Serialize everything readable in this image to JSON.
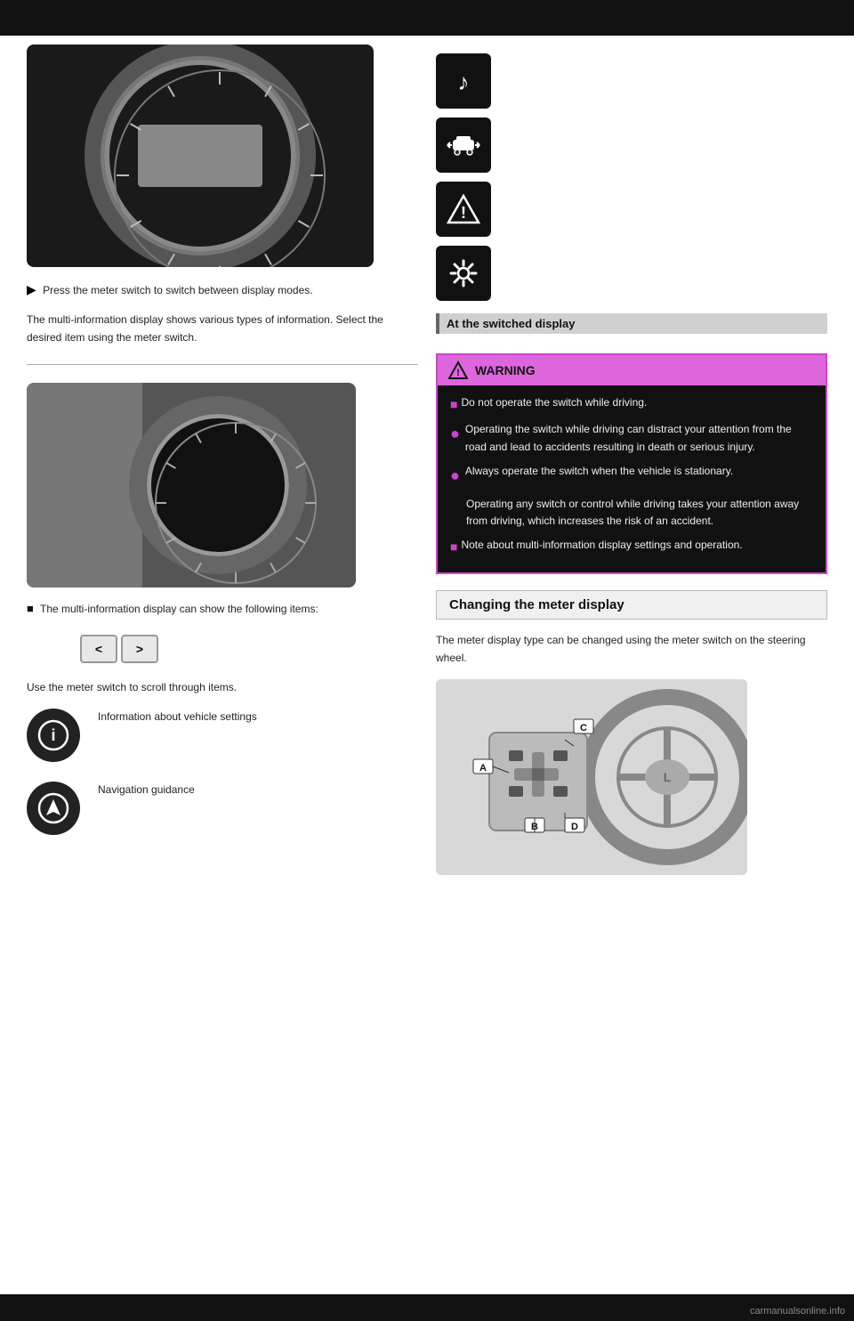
{
  "topBar": {
    "color": "#111"
  },
  "leftCol": {
    "gauge1": {
      "alt": "Instrument cluster gauge display"
    },
    "gauge1Label": "Press the meter switch to switch between display modes.",
    "gauge1Arrow": "▶",
    "gauge1Body": "The multi-information display shows various types of information. Select the desired item using the meter switch.",
    "gauge2": {
      "alt": "Instrument cluster gauge display variant"
    },
    "gauge2SquareBullet": "■",
    "gauge2Label": "The multi-information display can show the following items:",
    "navButtons": {
      "prev": "<",
      "next": ">"
    },
    "navLabel": "Use the meter switch to scroll through items.",
    "infoText1": "Information about vehicle settings",
    "infoText2": "Navigation guidance",
    "infoIcon1Alt": "info circle icon",
    "infoIcon2Alt": "navigation icon"
  },
  "rightCol": {
    "icons": [
      {
        "alt": "music note icon",
        "symbol": "♪"
      },
      {
        "alt": "car with arrows icon",
        "symbol": "🚗"
      },
      {
        "alt": "warning triangle icon",
        "symbol": "⚠"
      },
      {
        "alt": "settings gear icon",
        "symbol": "⚙"
      }
    ],
    "highlightLabel": "At the switched display",
    "warning": {
      "title": "WARNING",
      "bullet1Header": "■",
      "bullet1": "Do not operate the switch while driving.",
      "bullet2": "Operating the switch while driving can distract your attention from the road and lead to accidents resulting in death or serious injury.",
      "bullet3": "Always operate the switch when the vehicle is stationary.",
      "bullet3detail": "Operating any switch or control while driving takes your attention away from driving, which increases the risk of an accident.",
      "bullet4Header": "■",
      "bullet4": "Note about multi-information display settings and operation."
    },
    "sectionHeading": "Changing the meter display",
    "sectionBody": "The meter display type can be changed using the meter switch on the steering wheel.",
    "steeringAlt": "Steering wheel switch panel with labels A, B, C, D",
    "steeringLabels": {
      "A": "A",
      "B": "B",
      "C": "C",
      "D": "D"
    }
  },
  "watermark": "carmanualsonline.info"
}
